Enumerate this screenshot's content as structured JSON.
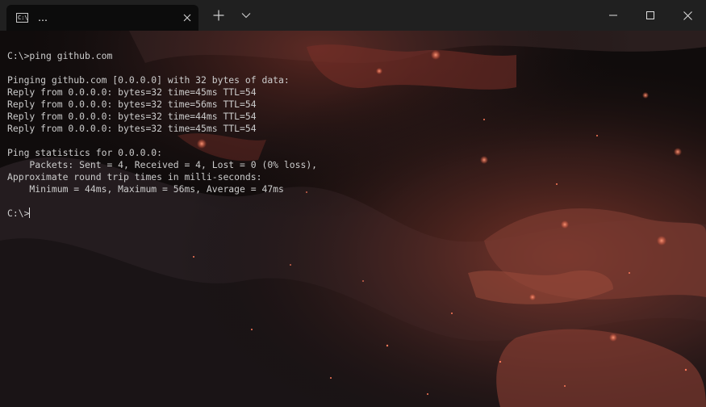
{
  "tab": {
    "icon_text": "C:\\",
    "title": "…"
  },
  "terminal": {
    "lines": [
      "C:\\>ping github.com",
      "",
      "Pinging github.com [0.0.0.0] with 32 bytes of data:",
      "Reply from 0.0.0.0: bytes=32 time=45ms TTL=54",
      "Reply from 0.0.0.0: bytes=32 time=56ms TTL=54",
      "Reply from 0.0.0.0: bytes=32 time=44ms TTL=54",
      "Reply from 0.0.0.0: bytes=32 time=45ms TTL=54",
      "",
      "Ping statistics for 0.0.0.0:",
      "    Packets: Sent = 4, Received = 4, Lost = 0 (0% loss),",
      "Approximate round trip times in milli-seconds:",
      "    Minimum = 44ms, Maximum = 56ms, Average = 47ms",
      ""
    ],
    "prompt": "C:\\>"
  },
  "colors": {
    "titlebar": "#202020",
    "tab_background": "#0c0c0c",
    "text": "#cccccc",
    "accent_ember": "#e0553a"
  },
  "icons": {
    "tab_icon": "command-prompt-icon",
    "tab_close": "close-icon",
    "new_tab": "plus-icon",
    "dropdown": "chevron-down-icon",
    "minimize": "minimize-icon",
    "maximize": "maximize-icon",
    "close": "close-icon"
  }
}
